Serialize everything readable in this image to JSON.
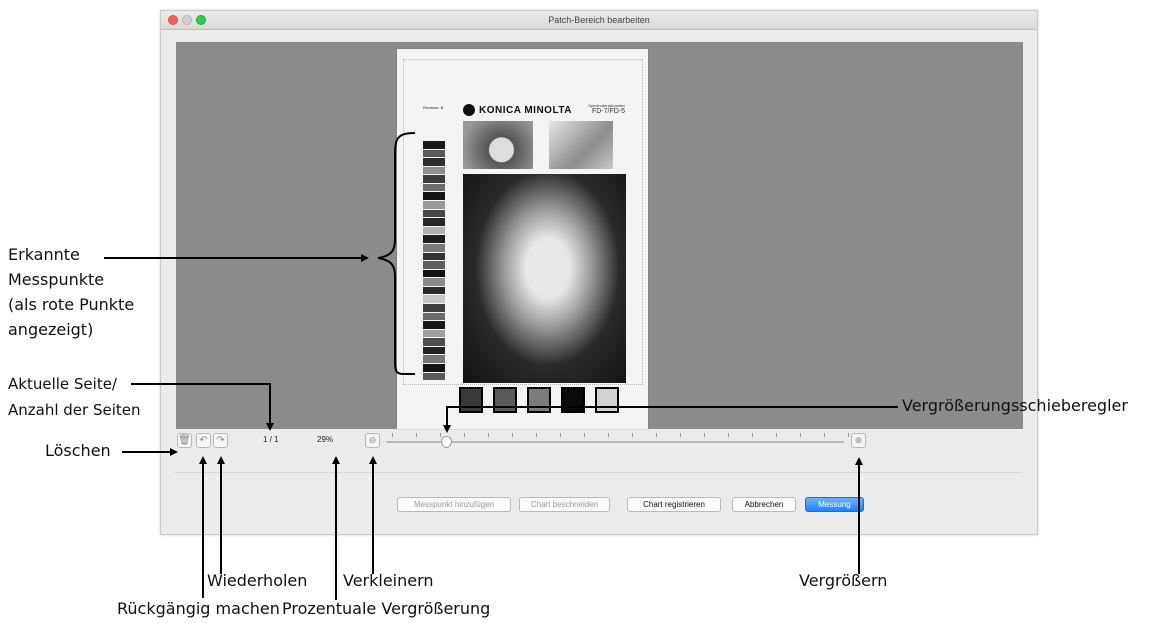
{
  "window": {
    "title": "Patch-Bereich bearbeiten"
  },
  "paper": {
    "brand": "KONICA MINOLTA",
    "model_small": "Spectrodensitometer",
    "model": "FD-7/FD-5",
    "strip_label": "Revision: B",
    "strip_colors": [
      "#1a1a1a",
      "#5a5a5a",
      "#2d2d2d",
      "#8d8d8d",
      "#3b3b3b",
      "#6b6b6b",
      "#141414",
      "#9a9a9a",
      "#474747",
      "#262626",
      "#b3b3b3",
      "#1f1f1f",
      "#7b7b7b",
      "#333333",
      "#5f5f5f",
      "#111111",
      "#8a8a8a",
      "#2a2a2a",
      "#c7c7c7",
      "#3e3e3e",
      "#6a6a6a",
      "#181818",
      "#a0a0a0",
      "#4d4d4d",
      "#232323",
      "#777777",
      "#141414",
      "#5a5a5a"
    ],
    "swatch_colors": [
      "#3a3a3a",
      "#5a5a5a",
      "#7b7b7b",
      "#0b0b0b",
      "#d2d2d2"
    ]
  },
  "toolbar": {
    "delete_icon": "trash-icon",
    "undo_icon": "undo-icon",
    "redo_icon": "redo-icon",
    "page_indicator": "1 / 1",
    "zoom_percent": "29%",
    "zoom_out_icon": "zoom-out-icon",
    "zoom_in_icon": "zoom-in-icon",
    "zoom_slider_value": 0.12
  },
  "buttons": {
    "add_point": "Messpunkt hinzufügen",
    "crop_chart": "Chart beschneiden",
    "register_chart": "Chart registrieren",
    "cancel": "Abbrechen",
    "measure": "Messung"
  },
  "annotations": {
    "detected_points": [
      "Erkannte",
      "Messpunkte",
      "(als rote Punkte",
      "angezeigt)"
    ],
    "current_page_1": "Aktuelle Seite/",
    "current_page_2": "Anzahl der Seiten",
    "delete": "Löschen",
    "redo": "Wiederholen",
    "undo": "Rückgängig machen",
    "zoom_out": "Verkleinern",
    "zoom_percent": "Prozentuale Vergrößerung",
    "zoom_slider": "Vergrößerungsschieberegler",
    "zoom_in": "Vergrößern"
  }
}
